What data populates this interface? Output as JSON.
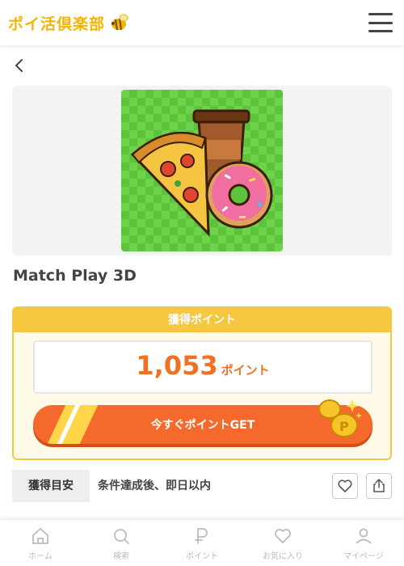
{
  "header": {
    "logo_text": "ポイ活倶楽部",
    "logo_icon": "bee-icon",
    "menu_icon": "hamburger-menu-icon"
  },
  "nav": {
    "back_icon": "chevron-left-icon"
  },
  "app": {
    "title": "Match Play 3D",
    "icon": "pizza-coffee-donut-app-icon"
  },
  "points": {
    "header_label": "獲得ポイント",
    "value": "1,053",
    "unit": "ポイント",
    "cta_label": "今すぐポイントGET",
    "coin_icon": "gold-coin-icon"
  },
  "eta": {
    "label": "獲得目安",
    "value": "条件達成後、即日以内",
    "favorite_icon": "heart-icon",
    "share_icon": "share-icon"
  },
  "tabbar": {
    "items": [
      {
        "label": "ホーム",
        "icon": "home-icon"
      },
      {
        "label": "検索",
        "icon": "search-icon"
      },
      {
        "label": "ポイント",
        "icon": "point-p-icon"
      },
      {
        "label": "お気に入り",
        "icon": "heart-icon"
      },
      {
        "label": "マイページ",
        "icon": "user-icon"
      }
    ]
  },
  "colors": {
    "accent_orange": "#f56a2c",
    "points_orange": "#f36f21",
    "card_yellow": "#f6c840",
    "logo_yellow": "#f4b400",
    "tab_gray": "#bbbbbb"
  }
}
